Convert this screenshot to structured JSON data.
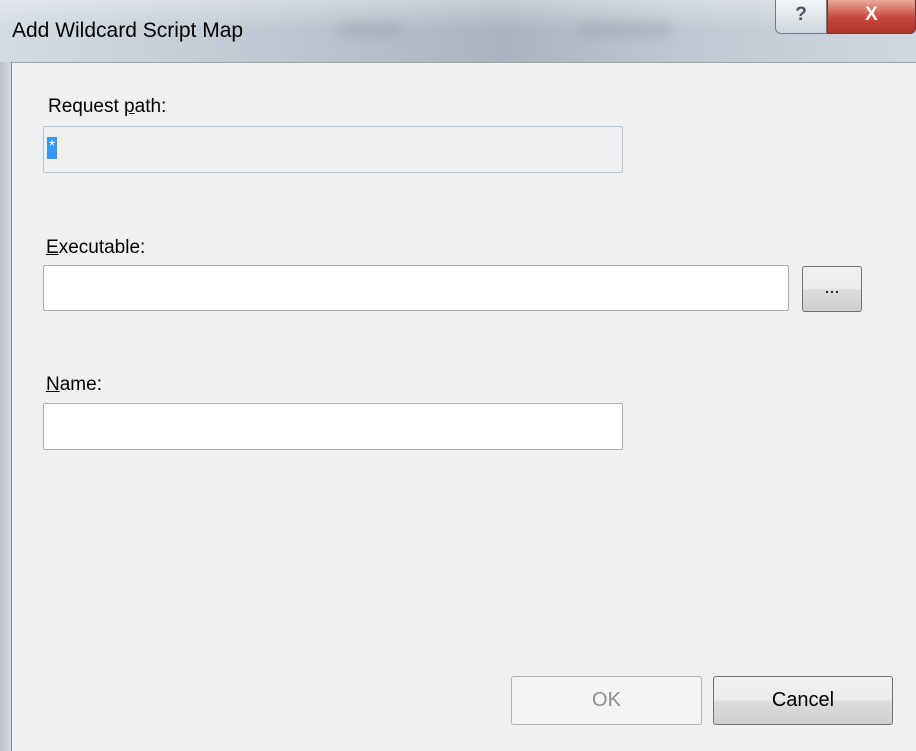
{
  "window": {
    "title": "Add Wildcard Script Map",
    "help_glyph": "?",
    "close_glyph": "X"
  },
  "request_path": {
    "label_prefix": "Request ",
    "label_mnemonic": "p",
    "label_suffix": "ath:",
    "value": "*"
  },
  "executable": {
    "label_mnemonic": "E",
    "label_suffix": "xecutable:",
    "value": "",
    "browse_label": "..."
  },
  "name": {
    "label_mnemonic": "N",
    "label_suffix": "ame:",
    "value": ""
  },
  "buttons": {
    "ok_label": "OK",
    "cancel_label": "Cancel"
  },
  "colors": {
    "selection": "#3399ff",
    "close_button": "#c5463a",
    "dialog_background": "#f0f0f0"
  }
}
